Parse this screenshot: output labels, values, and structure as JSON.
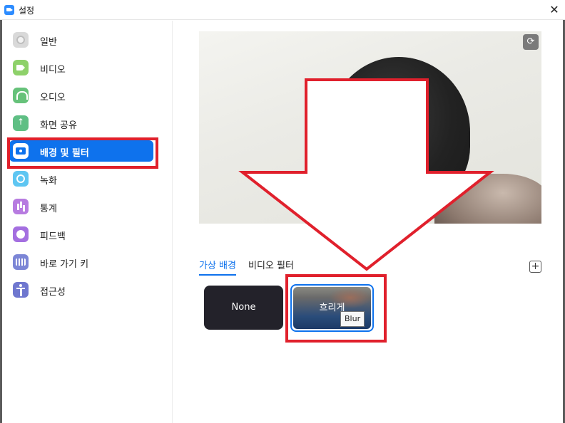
{
  "window": {
    "title": "설정",
    "close_glyph": "✕"
  },
  "sidebar": {
    "items": [
      {
        "label": "일반",
        "icon": "gear-icon"
      },
      {
        "label": "비디오",
        "icon": "video-camera-icon"
      },
      {
        "label": "오디오",
        "icon": "headphones-icon"
      },
      {
        "label": "화면 공유",
        "icon": "share-screen-icon"
      },
      {
        "label": "배경 및 필터",
        "icon": "background-person-icon",
        "active": true
      },
      {
        "label": "녹화",
        "icon": "record-icon"
      },
      {
        "label": "통계",
        "icon": "bar-chart-icon"
      },
      {
        "label": "피드백",
        "icon": "smiley-icon"
      },
      {
        "label": "바로 가기 키",
        "icon": "keyboard-icon"
      },
      {
        "label": "접근성",
        "icon": "accessibility-icon"
      }
    ]
  },
  "main": {
    "tabs": [
      {
        "label": "가상 배경",
        "active": true
      },
      {
        "label": "비디오 필터",
        "active": false
      }
    ],
    "add_glyph": "+",
    "rotate_glyph": "⟳",
    "backgrounds": [
      {
        "label": "None"
      },
      {
        "label": "흐리게",
        "selected": true,
        "tooltip": "Blur"
      }
    ]
  },
  "colors": {
    "accent": "#0e72ed",
    "annotation_red": "#e0202c"
  }
}
